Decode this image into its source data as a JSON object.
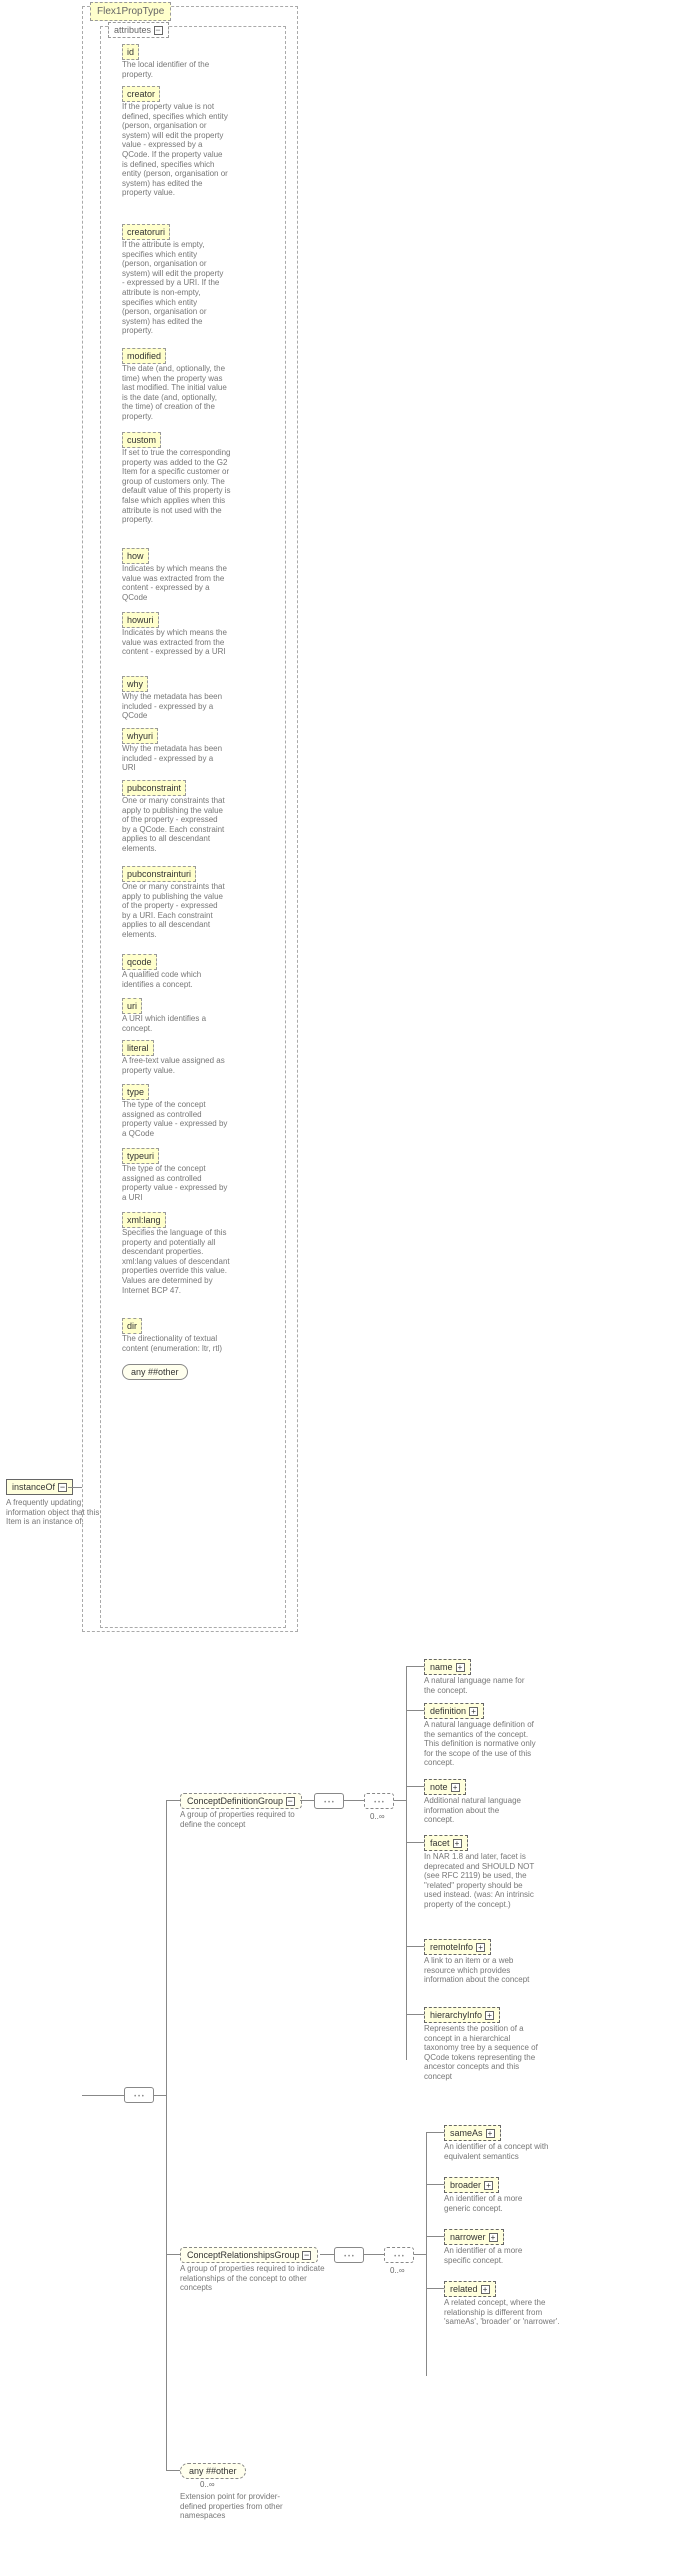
{
  "root": {
    "element": "instanceOf",
    "desc": "A frequently updating information object that this Item is an instance of.",
    "type": "Flex1PropType",
    "attributes_label": "attributes"
  },
  "attrs": {
    "id": {
      "label": "id",
      "desc": "The local identifier of the property."
    },
    "creator": {
      "label": "creator",
      "desc": "If the property value is not defined, specifies which entity (person, organisation or system) will edit the property value - expressed by a QCode. If the property value is defined, specifies which entity (person, organisation or system) has edited the property value."
    },
    "creatoruri": {
      "label": "creatoruri",
      "desc": "If the attribute is empty, specifies which entity (person, organisation or system) will edit the property - expressed by a URI. If the attribute is non-empty, specifies which entity (person, organisation or system) has edited the property."
    },
    "modified": {
      "label": "modified",
      "desc": "The date (and, optionally, the time) when the property was last modified. The initial value is the date (and, optionally, the time) of creation of the property."
    },
    "custom": {
      "label": "custom",
      "desc": "If set to true the corresponding property was added to the G2 Item for a specific customer or group of customers only. The default value of this property is false which applies when this attribute is not used with the property."
    },
    "how": {
      "label": "how",
      "desc": "Indicates by which means the value was extracted from the content - expressed by a QCode"
    },
    "howuri": {
      "label": "howuri",
      "desc": "Indicates by which means the value was extracted from the content - expressed by a URI"
    },
    "why": {
      "label": "why",
      "desc": "Why the metadata has been included - expressed by a QCode"
    },
    "whyuri": {
      "label": "whyuri",
      "desc": "Why the metadata has been included - expressed by a URI"
    },
    "pubconstraint": {
      "label": "pubconstraint",
      "desc": "One or many constraints that apply to publishing the value of the property - expressed by a QCode. Each constraint applies to all descendant elements."
    },
    "pubconstrainturi": {
      "label": "pubconstrainturi",
      "desc": "One or many constraints that apply to publishing the value of the property - expressed by a URI. Each constraint applies to all descendant elements."
    },
    "qcode": {
      "label": "qcode",
      "desc": "A qualified code which identifies a concept."
    },
    "uri": {
      "label": "uri",
      "desc": "A URI which identifies a concept."
    },
    "literal": {
      "label": "literal",
      "desc": "A free-text value assigned as property value."
    },
    "type": {
      "label": "type",
      "desc": "The type of the concept assigned as controlled property value - expressed by a QCode"
    },
    "typeuri": {
      "label": "typeuri",
      "desc": "The type of the concept assigned as controlled property value - expressed by a URI"
    },
    "xmllang": {
      "label": "xml:lang",
      "desc": "Specifies the language of this property and potentially all descendant properties. xml:lang values of descendant properties override this value. Values are determined by Internet BCP 47."
    },
    "dir": {
      "label": "dir",
      "desc": "The directionality of textual content (enumeration: ltr, rtl)"
    },
    "anyother": "any ##other"
  },
  "groups": {
    "cdg": {
      "label": "ConceptDefinitionGroup",
      "desc": "A group of properties required to define the concept"
    },
    "crg": {
      "label": "ConceptRelationshipsGroup",
      "desc": "A group of properties required to indicate relationships of the concept to other concepts"
    }
  },
  "elements": {
    "name": {
      "label": "name",
      "desc": "A natural language name for the concept."
    },
    "definition": {
      "label": "definition",
      "desc": "A natural language definition of the semantics of the concept. This definition is normative only for the scope of the use of this concept."
    },
    "note": {
      "label": "note",
      "desc": "Additional natural language information about the concept."
    },
    "facet": {
      "label": "facet",
      "desc": "In NAR 1.8 and later, facet is deprecated and SHOULD NOT (see RFC 2119) be used, the \"related\" property should be used instead. (was: An intrinsic property of the concept.)"
    },
    "remoteInfo": {
      "label": "remoteInfo",
      "desc": "A link to an item or a web resource which provides information about the concept"
    },
    "hierarchyInfo": {
      "label": "hierarchyInfo",
      "desc": "Represents the position of a concept in a hierarchical taxonomy tree by a sequence of QCode tokens representing the ancestor concepts and this concept"
    },
    "sameAs": {
      "label": "sameAs",
      "desc": "An identifier of a concept with equivalent semantics"
    },
    "broader": {
      "label": "broader",
      "desc": "An identifier of a more generic concept."
    },
    "narrower": {
      "label": "narrower",
      "desc": "An identifier of a more specific concept."
    },
    "related": {
      "label": "related",
      "desc": "A related concept, where the relationship is different from 'sameAs', 'broader' or 'narrower'."
    }
  },
  "ext": {
    "label": "any ##other",
    "card": "0..∞",
    "desc": "Extension point for provider-defined properties from other namespaces"
  },
  "cardinf": "0..∞"
}
